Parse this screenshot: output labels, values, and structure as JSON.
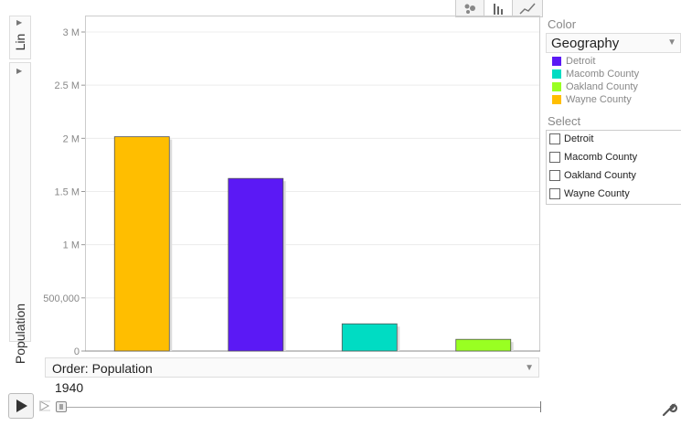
{
  "y_axis_selector": {
    "label": "Population"
  },
  "size_selector": {
    "label": "Lin"
  },
  "view_buttons": [
    {
      "icon": "bubble-chart-icon"
    },
    {
      "icon": "bar-chart-icon"
    },
    {
      "icon": "line-chart-icon"
    }
  ],
  "color_panel": {
    "heading": "Color",
    "selected": "Geography",
    "legend": [
      {
        "label": "Detroit",
        "color": "#5b19f5"
      },
      {
        "label": "Macomb County",
        "color": "#00dcc3"
      },
      {
        "label": "Oakland County",
        "color": "#99ff22"
      },
      {
        "label": "Wayne County",
        "color": "#ffbe00"
      }
    ]
  },
  "select_panel": {
    "heading": "Select",
    "items": [
      "Detroit",
      "Macomb County",
      "Oakland County",
      "Wayne County"
    ]
  },
  "order_selector": {
    "label": "Order: Population"
  },
  "timeline": {
    "year": "1940"
  },
  "chart_data": {
    "type": "bar",
    "categories": [
      "Wayne County",
      "Detroit",
      "Macomb County",
      "Oakland County"
    ],
    "values": [
      2015000,
      1623000,
      256000,
      110000
    ],
    "colors": [
      "#ffbe00",
      "#5b19f5",
      "#00dcc3",
      "#99ff22"
    ],
    "ylim": [
      0,
      3000000
    ],
    "yticks": [
      0,
      500000,
      1000000,
      1500000,
      2000000,
      2500000,
      3000000
    ],
    "ytick_labels": [
      "0",
      "500,000",
      "1 M",
      "1.5 M",
      "2 M",
      "2.5 M",
      "3 M"
    ],
    "grid": true
  }
}
